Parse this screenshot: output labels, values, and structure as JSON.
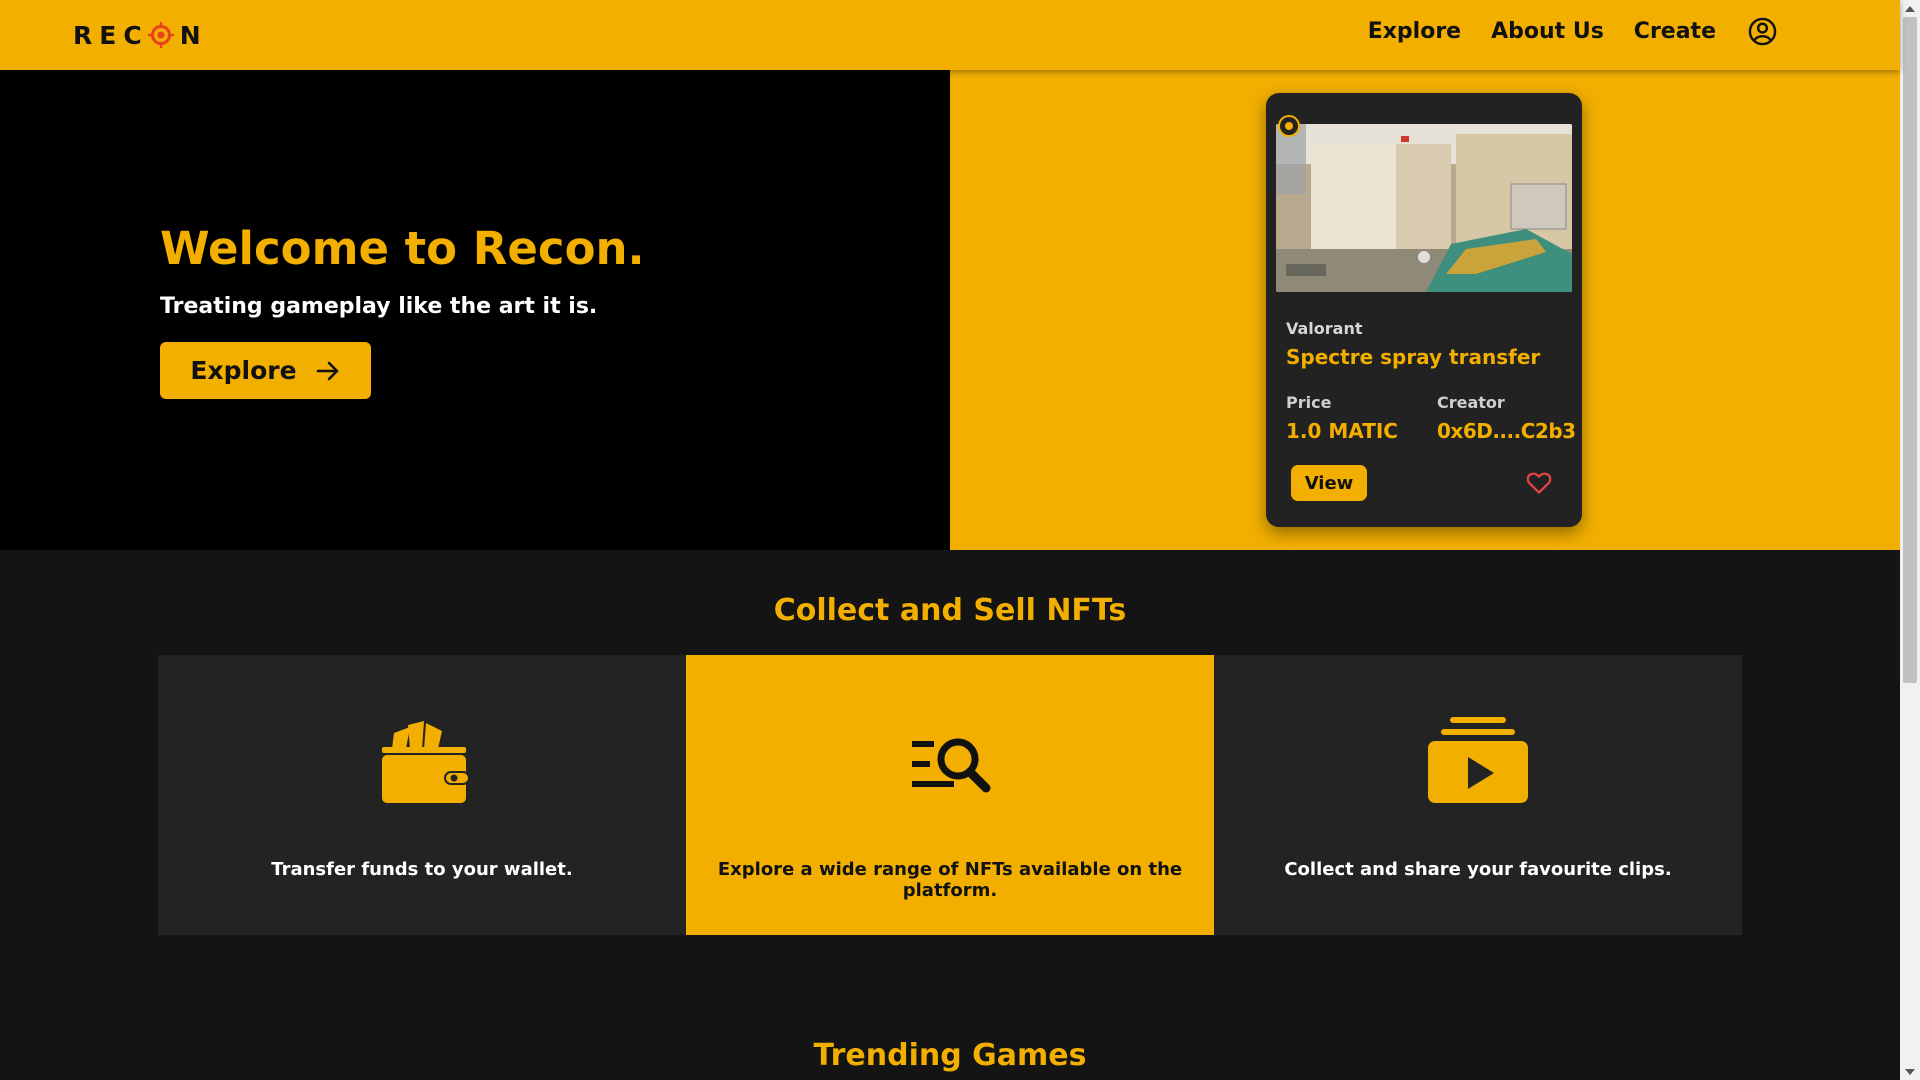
{
  "nav": {
    "logo_prefix": "REC",
    "logo_suffix": "N",
    "links": [
      "Explore",
      "About Us",
      "Create"
    ],
    "user_icon": "user-circle-icon"
  },
  "hero": {
    "title": "Welcome to Recon.",
    "subtitle": "Treating gameplay like the art it is.",
    "button_label": "Explore",
    "button_icon": "arrow-right-icon"
  },
  "card": {
    "game": "Valorant",
    "title": "Spectre spray transfer",
    "price_label": "Price",
    "price": "1.0 MATIC",
    "creator_label": "Creator",
    "creator": "0x6D....C2b3",
    "view_label": "View",
    "heart_icon": "heart-icon"
  },
  "collect": {
    "title": "Collect and Sell NFTs",
    "features": [
      {
        "icon": "wallet-icon",
        "text": "Transfer funds to your wallet."
      },
      {
        "icon": "search-list-icon",
        "text": "Explore a wide range of NFTs available on the platform."
      },
      {
        "icon": "video-playlist-icon",
        "text": "Collect and share your favourite clips."
      }
    ]
  },
  "trending": {
    "title": "Trending Games"
  },
  "colors": {
    "accent": "#F2AF00",
    "background": "#141414",
    "card": "#222222",
    "tile": "#232323",
    "heart": "#E84545"
  }
}
